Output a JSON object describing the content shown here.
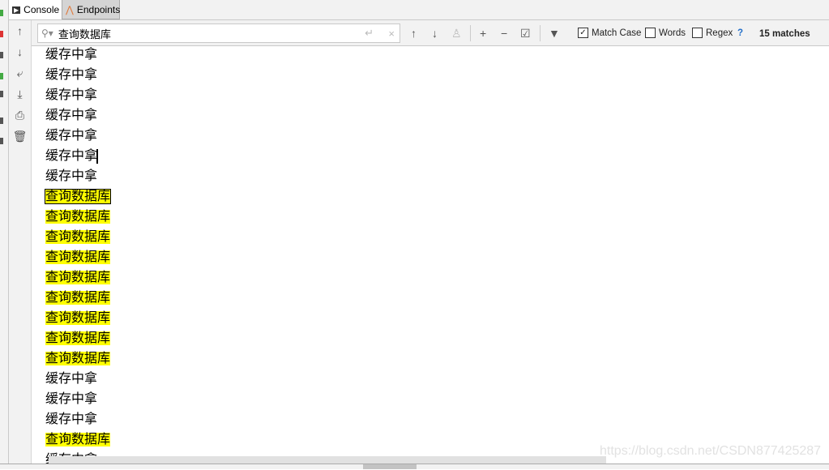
{
  "tabs": [
    {
      "label": "Console",
      "icon": "console-icon"
    },
    {
      "label": "Endpoints",
      "icon": "endpoints-icon"
    }
  ],
  "search": {
    "value": "查询数据库",
    "match_case": {
      "label": "Match Case",
      "checked": true
    },
    "words": {
      "label": "Words",
      "checked": false
    },
    "regex": {
      "label": "Regex",
      "checked": false
    },
    "help": "?",
    "matches": "15 matches"
  },
  "lines": [
    {
      "text": "缓存中拿",
      "match": false
    },
    {
      "text": "缓存中拿",
      "match": false
    },
    {
      "text": "缓存中拿",
      "match": false
    },
    {
      "text": "缓存中拿",
      "match": false
    },
    {
      "text": "缓存中拿",
      "match": false
    },
    {
      "text": "缓存中拿",
      "match": false
    },
    {
      "text": "缓存中拿",
      "match": false
    },
    {
      "text": "查询数据库",
      "match": true,
      "current": true
    },
    {
      "text": "查询数据库",
      "match": true
    },
    {
      "text": "查询数据库",
      "match": true
    },
    {
      "text": "查询数据库",
      "match": true
    },
    {
      "text": "查询数据库",
      "match": true
    },
    {
      "text": "查询数据库",
      "match": true
    },
    {
      "text": "查询数据库",
      "match": true
    },
    {
      "text": "查询数据库",
      "match": true
    },
    {
      "text": "查询数据库",
      "match": true
    },
    {
      "text": "缓存中拿",
      "match": false
    },
    {
      "text": "缓存中拿",
      "match": false
    },
    {
      "text": "缓存中拿",
      "match": false
    },
    {
      "text": "查询数据库",
      "match": true
    },
    {
      "text": "缓存中拿",
      "match": false
    }
  ],
  "watermark": "https://blog.csdn.net/CSDN877425287",
  "colors": {
    "highlight": "#ffff00",
    "accent": "#2470c9"
  }
}
